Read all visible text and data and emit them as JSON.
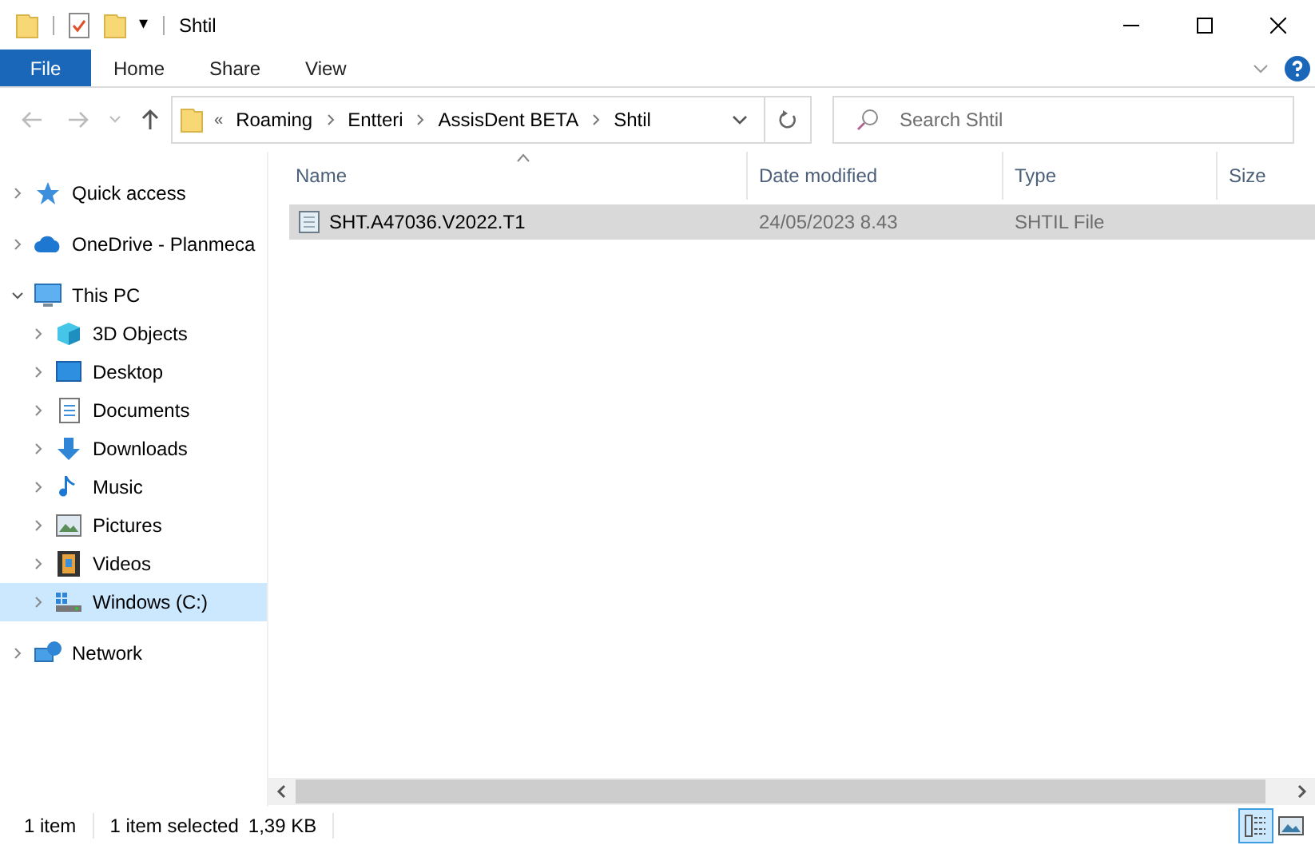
{
  "window": {
    "title": "Shtil",
    "quick_access_dropdown": "▾"
  },
  "ribbon": {
    "tabs": [
      {
        "label": "File",
        "kind": "file"
      },
      {
        "label": "Home",
        "kind": "tab"
      },
      {
        "label": "Share",
        "kind": "tab"
      },
      {
        "label": "View",
        "kind": "tab"
      }
    ]
  },
  "address_bar": {
    "overflow": "«",
    "crumbs": [
      "Roaming",
      "Entteri",
      "AssisDent BETA",
      "Shtil"
    ]
  },
  "search": {
    "placeholder": "Search Shtil"
  },
  "navigation": [
    {
      "label": "Quick access",
      "expanded": false,
      "selected": false
    },
    {
      "label": "OneDrive - Planmeca",
      "expanded": false,
      "selected": false
    },
    {
      "label": "This PC",
      "expanded": true,
      "selected": false,
      "children": [
        {
          "label": "3D Objects",
          "expanded": false,
          "selected": false
        },
        {
          "label": "Desktop",
          "expanded": false,
          "selected": false
        },
        {
          "label": "Documents",
          "expanded": false,
          "selected": false
        },
        {
          "label": "Downloads",
          "expanded": false,
          "selected": false
        },
        {
          "label": "Music",
          "expanded": false,
          "selected": false
        },
        {
          "label": "Pictures",
          "expanded": false,
          "selected": false
        },
        {
          "label": "Videos",
          "expanded": false,
          "selected": false
        },
        {
          "label": "Windows (C:)",
          "expanded": false,
          "selected": true
        }
      ]
    },
    {
      "label": "Network",
      "expanded": false,
      "selected": false
    }
  ],
  "table": {
    "columns": [
      "Name",
      "Date modified",
      "Type",
      "Size"
    ],
    "rows": [
      {
        "name": "SHT.A47036.V2022.T1",
        "date_modified": "24/05/2023 8.43",
        "type": "SHTIL File",
        "selected": true
      }
    ]
  },
  "status_bar": {
    "item_count": "1 item",
    "selection": "1 item selected",
    "size": "1,39 KB",
    "views": [
      {
        "kind": "details",
        "selected": true
      },
      {
        "kind": "large-icons",
        "selected": false
      }
    ]
  }
}
